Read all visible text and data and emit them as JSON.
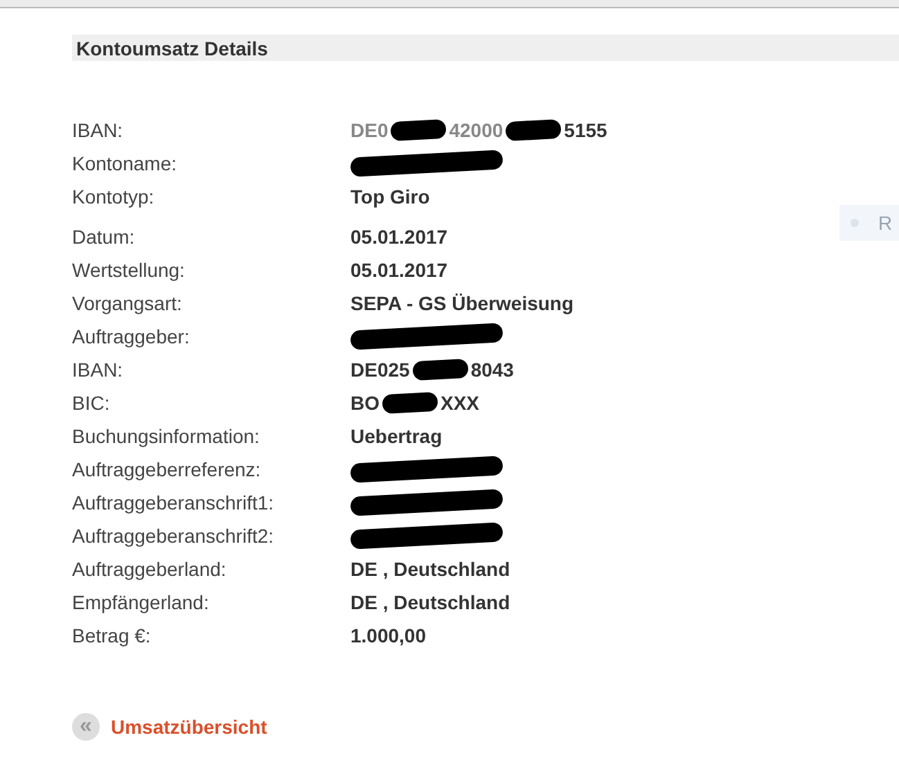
{
  "section": {
    "title": "Kontoumsatz Details"
  },
  "side_button": {
    "label": "R"
  },
  "groups": [
    [
      {
        "label": "IBAN:",
        "value": [
          {
            "kind": "text",
            "text": "DE0",
            "muted": true
          },
          {
            "kind": "redaction"
          },
          {
            "kind": "text",
            "text": "42000",
            "muted": true
          },
          {
            "kind": "redaction"
          },
          {
            "kind": "text",
            "text": "5155",
            "muted": false
          }
        ]
      },
      {
        "label": "Kontoname:",
        "value": [
          {
            "kind": "redaction"
          }
        ]
      },
      {
        "label": "Kontotyp:",
        "value": [
          {
            "kind": "text",
            "text": "Top Giro",
            "muted": false
          }
        ]
      }
    ],
    [
      {
        "label": "Datum:",
        "value": [
          {
            "kind": "text",
            "text": "05.01.2017",
            "muted": false
          }
        ]
      },
      {
        "label": "Wertstellung:",
        "value": [
          {
            "kind": "text",
            "text": "05.01.2017",
            "muted": false
          }
        ]
      },
      {
        "label": "Vorgangsart:",
        "value": [
          {
            "kind": "text",
            "text": "SEPA - GS Überweisung",
            "muted": false
          }
        ]
      },
      {
        "label": "Auftraggeber:",
        "value": [
          {
            "kind": "redaction"
          }
        ]
      },
      {
        "label": "IBAN:",
        "value": [
          {
            "kind": "text",
            "text": "DE025",
            "muted": false
          },
          {
            "kind": "redaction"
          },
          {
            "kind": "text",
            "text": "8043",
            "muted": false
          }
        ]
      },
      {
        "label": "BIC:",
        "value": [
          {
            "kind": "text",
            "text": "BO",
            "muted": false
          },
          {
            "kind": "redaction"
          },
          {
            "kind": "text",
            "text": "XXX",
            "muted": false
          }
        ]
      },
      {
        "label": "Buchungsinformation:",
        "value": [
          {
            "kind": "text",
            "text": "Uebertrag",
            "muted": false
          }
        ]
      },
      {
        "label": "Auftraggeberreferenz:",
        "value": [
          {
            "kind": "redaction"
          }
        ]
      },
      {
        "label": "Auftraggeberanschrift1:",
        "value": [
          {
            "kind": "redaction"
          }
        ]
      },
      {
        "label": "Auftraggeberanschrift2:",
        "value": [
          {
            "kind": "redaction"
          }
        ]
      },
      {
        "label": "Auftraggeberland:",
        "value": [
          {
            "kind": "text",
            "text": "DE , Deutschland",
            "muted": false
          }
        ]
      },
      {
        "label": "Empfängerland:",
        "value": [
          {
            "kind": "text",
            "text": "DE , Deutschland",
            "muted": false
          }
        ]
      },
      {
        "label": "Betrag €:",
        "value": [
          {
            "kind": "text",
            "text": "1.000,00",
            "muted": false
          }
        ]
      }
    ]
  ],
  "back_link": {
    "label": "Umsatzübersicht",
    "icon": "«"
  }
}
